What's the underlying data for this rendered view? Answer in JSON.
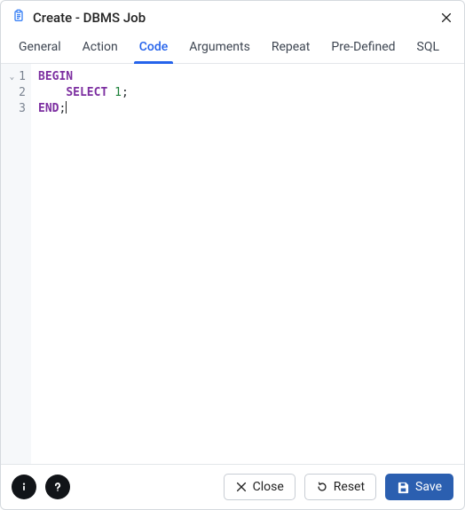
{
  "title": "Create - DBMS Job",
  "tabs": [
    {
      "label": "General",
      "active": false
    },
    {
      "label": "Action",
      "active": false
    },
    {
      "label": "Code",
      "active": true
    },
    {
      "label": "Arguments",
      "active": false
    },
    {
      "label": "Repeat",
      "active": false
    },
    {
      "label": "Pre-Defined",
      "active": false
    },
    {
      "label": "SQL",
      "active": false
    }
  ],
  "code": {
    "lines": [
      {
        "n": "1",
        "foldable": true,
        "indent": 0,
        "tokens": [
          {
            "t": "kw",
            "v": "BEGIN"
          }
        ]
      },
      {
        "n": "2",
        "foldable": false,
        "indent": 1,
        "tokens": [
          {
            "t": "kw",
            "v": "SELECT"
          },
          {
            "t": "sp",
            "v": " "
          },
          {
            "t": "num",
            "v": "1"
          },
          {
            "t": "punct",
            "v": ";"
          }
        ]
      },
      {
        "n": "3",
        "foldable": false,
        "indent": 0,
        "tokens": [
          {
            "t": "kw",
            "v": "END"
          },
          {
            "t": "punct",
            "v": ";"
          }
        ],
        "cursor_after": true
      }
    ]
  },
  "buttons": {
    "close": "Close",
    "reset": "Reset",
    "save": "Save"
  },
  "colors": {
    "accent": "#2563eb",
    "primary_button": "#2b5fb0"
  }
}
